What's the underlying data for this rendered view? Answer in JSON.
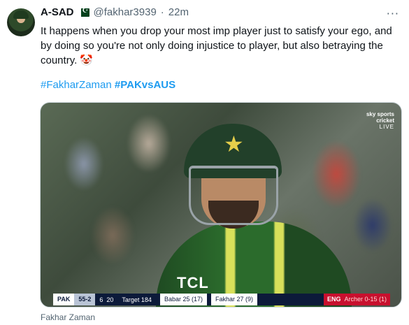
{
  "author": {
    "name": "A-SAD",
    "handle": "@fakhar3939",
    "separator": "·",
    "time": "22m"
  },
  "tweet": {
    "text": "It happens when you drop your most imp player just to satisfy your ego, and by doing so you're not only doing injustice to player, but also betraying the country.",
    "emoji": "🤡",
    "hashtags": [
      "#FakharZaman",
      "#PAKvsAUS"
    ]
  },
  "media": {
    "broadcaster": "sky sports",
    "channel": "cricket",
    "live": "LIVE",
    "jersey_text": "TCL",
    "scorebar": {
      "team": "PAK",
      "score": "55-2",
      "overs": "6",
      "overs_total": "20",
      "target": "Target 184",
      "batter1": "Babar 25",
      "batter1_balls": "(17)",
      "batter2": "Fakhar 27",
      "batter2_balls": "(9)",
      "opponent": "ENG",
      "bowler": "Archer 0-15",
      "bowler_overs": "(1)"
    },
    "caption": "Fakhar Zaman"
  },
  "icons": {
    "more": "more-horizontal-icon",
    "flag": "pakistan-flag-icon",
    "star": "star-icon"
  },
  "colors": {
    "link": "#1d9bf0",
    "muted": "#536471",
    "text": "#0f1419"
  }
}
